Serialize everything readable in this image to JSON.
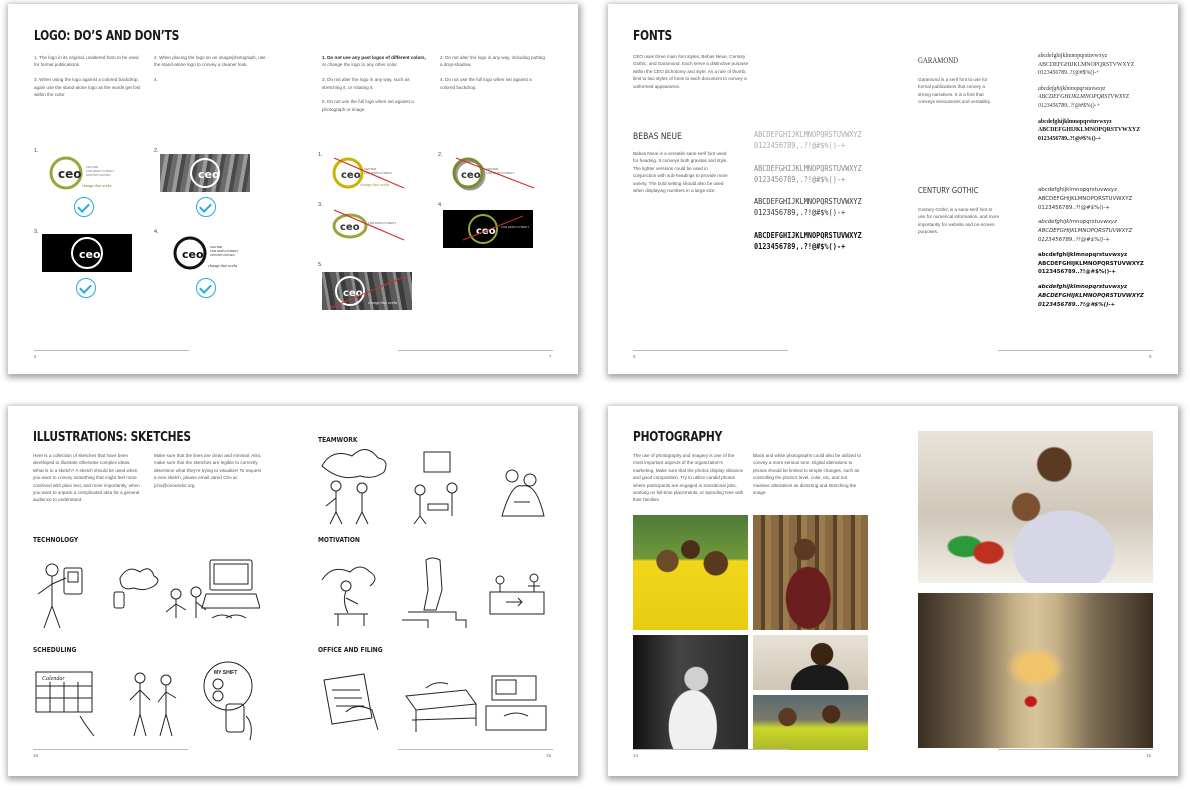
{
  "p1": {
    "title": "LOGO: DO’S AND DON’TS",
    "left_col1": "1. The logo in its original, unaltered form to be used for formal publications.\n\n3. When using the logo against a colored backdrop, again use the stand-alone logo as the words get lost within the color.",
    "left_col2": "2. When placing the logo on an image/photograph, use the stand-alone logo to convey a cleaner look.\n\n4.",
    "right_col1_bold": "1. Do not use any past logos of different colors,",
    "right_col1": " or change the logo to any other color.\n\n3. Do not alter the logo in any way, such as stretching it, or rotating it.\n\n5. Do not use the full logo when set against a photograph or image.",
    "right_col2": "2. Do not alter the logo in any way, including putting a drop-shadow.\n\n4. Do not use the full logo when set against a colored backdrop.",
    "labels": [
      "1.",
      "2.",
      "3.",
      "4.",
      "1.",
      "2.",
      "3.",
      "4.",
      "5."
    ],
    "logo_word": "ceo",
    "logo_tag": "change that works",
    "logo_lines": [
      "CENTER",
      "FOR EMPLOYMENT",
      "OPPORTUNITIES"
    ],
    "page_left": "6",
    "page_right": "7"
  },
  "p2": {
    "title": "FONTS",
    "intro": "CEO uses three main font styles, Bebas Neue, Century Gothic, and Garamond. Each serve a distinctive purpose within the CEO dichotomy and style. As a rule of thumb, limit to two styles of fonts to each document to convey a uniformed appearance.",
    "bebas_title": "BEBAS NEUE",
    "bebas_desc": "Bebas Neue is a versatile sans-serif font used for heading. It conveys both gravitas and style. The lighter versions could be used in conjunction with sub-headings to provide more variety. The bold setting should also be used when displaying numbers in a large size.",
    "bebas_samples": [
      "ABCDEFGHIJKLMNOPQRSTUVWXYZ",
      "0123456789,.?!@#$%()-+"
    ],
    "garamond_title": "GARAMOND",
    "garamond_desc": "Garamond is a serif font to use for formal publications that convey a strong narratives. It is a font that conveys seriousness and versatility.",
    "garamond_samples": [
      "abcdefghijklmnopqrstuvwxyz",
      "ABCDEFGHIJKLMNOPQRSTVWXYZ",
      "0123456789..?!@#$%()-+"
    ],
    "century_title": "CENTURY GOTHIC",
    "century_desc": "Century Gothic is a sans-serif font to use for numerical information, and more importantly for website and on-screen purposes.",
    "century_samples": [
      "abcdefghijklmnopqrstuvwxyz",
      "ABCDEFGHIJKLMNOPQRSTUVWXYZ",
      "0123456789..?!@#$%()-+"
    ],
    "page_left": "8",
    "page_right": "9"
  },
  "p3": {
    "title": "ILLUSTRATIONS: SKETCHES",
    "col1": "Here is a collection of sketches that have been developed to illustrate otherwise complex ideas. What is to a sketch? A sketch should be used when you want to convey something that might feel more contrived with plain text, and more importantly, when you want to unpack a complicated idea for a general audience to understand.",
    "col2": "Make sure that the lines are clean and minimal. Also, make sure that the sketches are legible to correctly determine what they’re trying to visualize! To request a new sketch, please email Jared Cho at jcho@ceoworks.org.",
    "sections": [
      "TECHNOLOGY",
      "SCHEDULING",
      "TEAMWORK",
      "MOTIVATION",
      "OFFICE AND FILING"
    ],
    "calendar_word": "Calendar",
    "clock_word": "MY SHIFT",
    "page_left": "18",
    "page_right": "19"
  },
  "p4": {
    "title": "PHOTOGRAPHY",
    "col1": "The use of photography and imagery is one of the most important aspects of the organization’s marketing. Make sure that the photos display vibrance and good composition. Try to utilize candid photos where participants are engaged in transitional jobs, working on full-time placements, or spending time with their families.",
    "col2": "Black and white photographs could also be utilized to convey a more serious tone. Digital alterations to photos should be limited to simple changes, such as controlling the photo’s level, color, etc, and not massive alterations as distorting and stretching the image.",
    "page_left": "14",
    "page_right": "15"
  },
  "colors": {
    "accent": "#29a9e0",
    "logo_green": "#9aa53a",
    "logo_olive": "#7d8a2b",
    "strike": "#d0312d"
  }
}
